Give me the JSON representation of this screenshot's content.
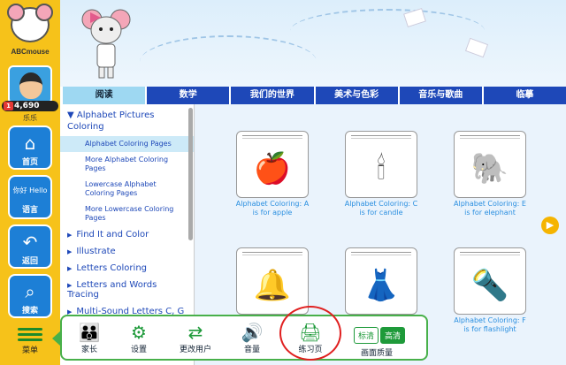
{
  "app": {
    "logo_text": "ABCmouse"
  },
  "user": {
    "points": "4,690",
    "badge": "1",
    "name": "乐乐"
  },
  "sidebar": {
    "buttons": [
      {
        "label": "首页",
        "icon": "home-icon"
      },
      {
        "label": "语言",
        "icon": "speech-bubble-icon"
      },
      {
        "label": "返回",
        "icon": "back-arrow-icon"
      },
      {
        "label": "搜索",
        "icon": "search-icon"
      }
    ],
    "speech_icon_text": {
      "left": "你好",
      "right": "Hello"
    },
    "menu_label": "菜单"
  },
  "tabs": [
    "阅读",
    "数学",
    "我们的世界",
    "美术与色彩",
    "音乐与歌曲",
    "临摹"
  ],
  "list": {
    "open_category": "Alphabet Pictures Coloring",
    "subitems": [
      "Alphabet Coloring Pages",
      "More Alphabet Coloring Pages",
      "Lowercase Alphabet Coloring Pages",
      "More Lowercase Coloring Pages"
    ],
    "categories": [
      "Find It and Color",
      "Illustrate",
      "Letters Coloring",
      "Letters and Words Tracing",
      "Multi-Sound Letters C, G"
    ]
  },
  "worksheets": [
    {
      "caption": "Alphabet Coloring: A is for apple",
      "icon": "apple-icon"
    },
    {
      "caption": "Alphabet Coloring: C is for candle",
      "icon": "candle-icon"
    },
    {
      "caption": "Alphabet Coloring: E is for elephant",
      "icon": "elephant-icon"
    },
    {
      "caption": "",
      "icon": "bell-icon"
    },
    {
      "caption": "",
      "icon": "dress-icon"
    },
    {
      "caption": "Alphabet Coloring: F is for flashlight",
      "icon": "flashlight-icon"
    }
  ],
  "toolbar": {
    "items": [
      {
        "label": "家长",
        "icon": "parents-icon"
      },
      {
        "label": "设置",
        "icon": "gear-icon"
      },
      {
        "label": "更改用户",
        "icon": "switch-user-icon"
      },
      {
        "label": "音量",
        "icon": "volume-icon"
      },
      {
        "label": "练习页",
        "icon": "printer-icon"
      }
    ],
    "quality_options": [
      "标清",
      "高清"
    ],
    "quality_label": "画面质量"
  },
  "colors": {
    "sidebar": "#f6c21a",
    "tab": "#1e48b8",
    "tab_active": "#9ed8f2",
    "toolbar_border": "#48b04a",
    "highlight": "#e02020"
  }
}
